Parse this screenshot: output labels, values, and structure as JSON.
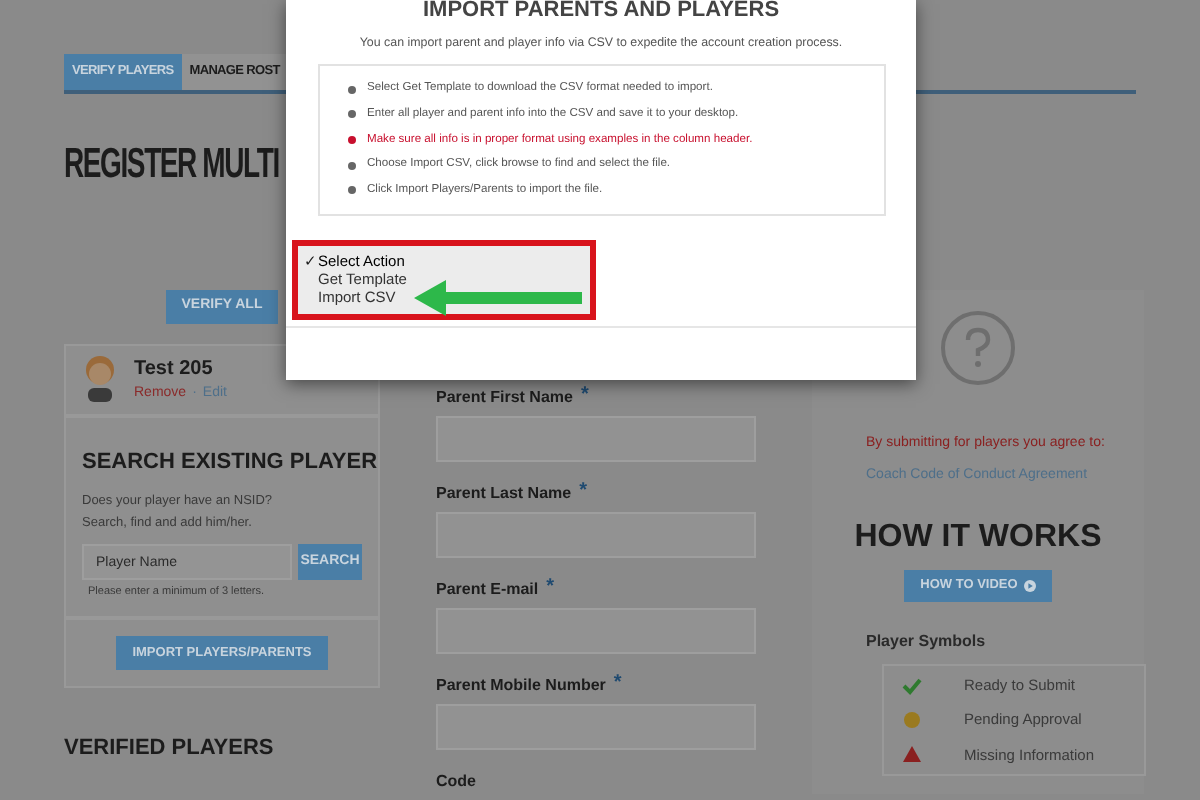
{
  "tabs": [
    {
      "label": "VERIFY PLAYERS",
      "selected": true
    },
    {
      "label": "MANAGE ROST",
      "selected": false
    }
  ],
  "page_title": "REGISTER MULTI",
  "verify_all_button": "VERIFY ALL",
  "player": {
    "name": "Test 205",
    "remove": "Remove",
    "separator": "·",
    "edit": "Edit"
  },
  "search": {
    "title": "SEARCH EXISTING PLAYER",
    "prompt_lines": [
      "Does your player have an NSID?",
      "Search, find and add him/her."
    ],
    "placeholder": "Player Name",
    "button": "SEARCH",
    "hint": "Please enter a minimum of 3 letters."
  },
  "import_button": "IMPORT PLAYERS/PARENTS",
  "verified_title": "VERIFIED PLAYERS",
  "required_mark": "*",
  "form_fields": [
    {
      "label": "Parent First Name",
      "required": true,
      "kind": "input"
    },
    {
      "label": "Parent Last Name",
      "required": true,
      "kind": "input"
    },
    {
      "label": "Parent E-mail",
      "required": true,
      "kind": "input"
    },
    {
      "label": "Parent Mobile Number",
      "required": true,
      "kind": "input"
    },
    {
      "label": "Code",
      "required": false,
      "kind": "label"
    }
  ],
  "agreement": {
    "notice": "By submitting for players you agree to:",
    "link": "Coach Code of Conduct Agreement"
  },
  "how_it_works": {
    "title": "HOW IT WORKS",
    "video_button": "HOW TO VIDEO"
  },
  "player_symbols": {
    "title": "Player Symbols",
    "items": [
      {
        "label": "Ready to Submit",
        "kind": "check",
        "color": "#2f7a2f"
      },
      {
        "label": "Pending Approval",
        "kind": "dot",
        "color": "#9a7a20"
      },
      {
        "label": "Missing Information",
        "kind": "warning",
        "color": "#8a2020"
      }
    ]
  },
  "modal": {
    "title": "IMPORT PARENTS AND PLAYERS",
    "subtitle": "You can import parent and player info via CSV to expedite the account creation process.",
    "steps": [
      {
        "text": "Select Get Template to download the CSV format needed to import.",
        "kind": "normal"
      },
      {
        "text": "Enter all player and parent info into the CSV and save it to your desktop.",
        "kind": "normal"
      },
      {
        "text": "Make sure all info is in proper format using examples in the column header.",
        "kind": "warning"
      },
      {
        "text": "Choose Import CSV, click browse to find and select the file.",
        "kind": "normal"
      },
      {
        "text": "Click Import Players/Parents to import the file.",
        "kind": "normal"
      }
    ],
    "selected_mark": "✓",
    "action_menu": [
      {
        "label": "Select Action",
        "selected": true
      },
      {
        "label": "Get Template",
        "selected": false
      },
      {
        "label": "Import CSV",
        "selected": false
      }
    ]
  }
}
